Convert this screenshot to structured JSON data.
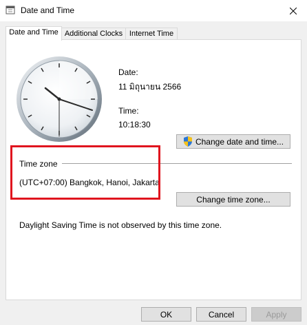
{
  "window": {
    "title": "Date and Time",
    "close_icon": "close-icon",
    "app_icon": "clock-app-icon"
  },
  "tabs": [
    {
      "label": "Date and Time",
      "active": true
    },
    {
      "label": "Additional Clocks",
      "active": false
    },
    {
      "label": "Internet Time",
      "active": false
    }
  ],
  "datetime": {
    "date_label": "Date:",
    "date_value": "11 มิถุนายน 2566",
    "time_label": "Time:",
    "time_value": "10:18:30",
    "change_datetime_button": "Change date and time...",
    "shield_icon": "uac-shield-icon"
  },
  "timezone": {
    "group_label": "Time zone",
    "value": "(UTC+07:00) Bangkok, Hanoi, Jakarta",
    "change_timezone_button": "Change time zone...",
    "dst_note": "Daylight Saving Time is not observed by this time zone."
  },
  "footer": {
    "ok": "OK",
    "cancel": "Cancel",
    "apply": "Apply"
  },
  "colors": {
    "highlight_border": "#e0141e",
    "accent": "#0078d7"
  }
}
